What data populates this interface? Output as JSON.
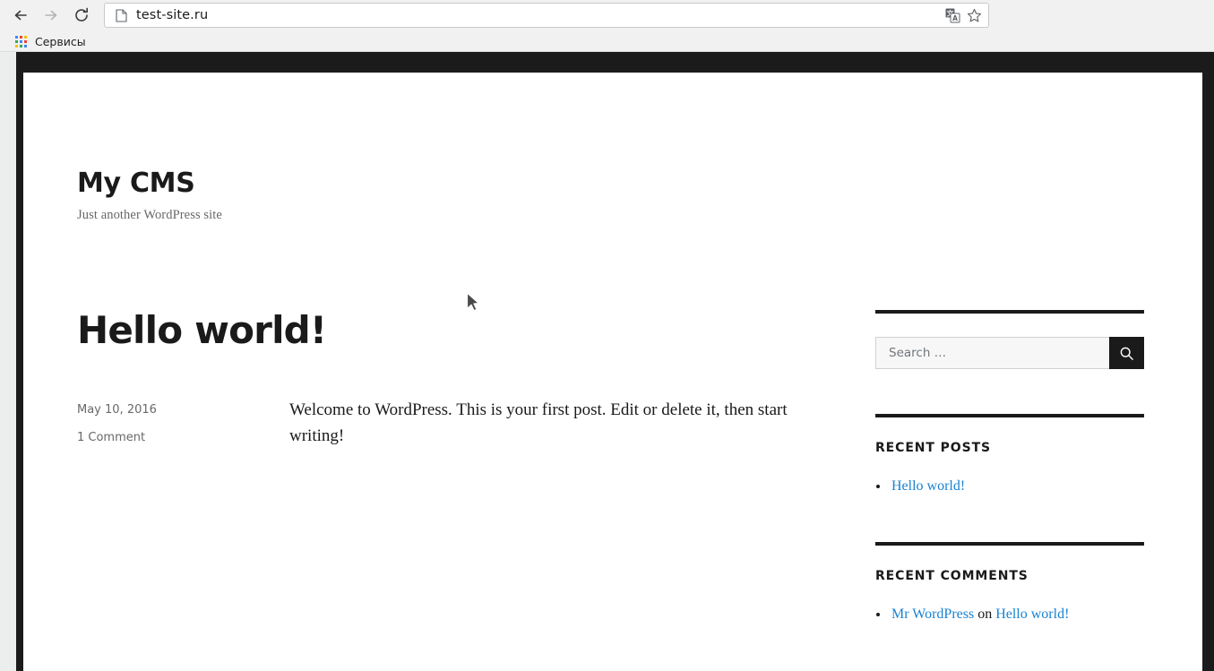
{
  "browser": {
    "nav": {
      "back_label": "Back",
      "forward_label": "Forward",
      "reload_label": "Reload"
    },
    "omnibox": {
      "url": "test-site.ru",
      "page_info_icon": "page-document-icon",
      "translate_icon": "translate-icon",
      "bookmark_icon": "star-icon"
    },
    "bookmarks": [
      {
        "label": "Сервисы",
        "icon": "apps-grid-icon"
      }
    ]
  },
  "site": {
    "title": "My CMS",
    "description": "Just another WordPress site"
  },
  "post": {
    "title": "Hello world!",
    "date": "May 10, 2016",
    "comments": "1 Comment",
    "content": "Welcome to WordPress. This is your first post. Edit or delete it, then start writing!"
  },
  "sidebar": {
    "search": {
      "placeholder": "Search …",
      "value": "",
      "submit_icon": "search-icon",
      "submit_label": "Search"
    },
    "recent_posts": {
      "title": "Recent Posts",
      "items": [
        {
          "label": "Hello world!"
        }
      ]
    },
    "recent_comments": {
      "title": "Recent Comments",
      "items": [
        {
          "author": "Mr WordPress",
          "on": "on",
          "post": "Hello world!"
        }
      ]
    }
  },
  "colors": {
    "link": "#1982d1",
    "frame": "#1b1b1b",
    "meta": "#686868",
    "chrome_bg": "#f1f1f1"
  }
}
